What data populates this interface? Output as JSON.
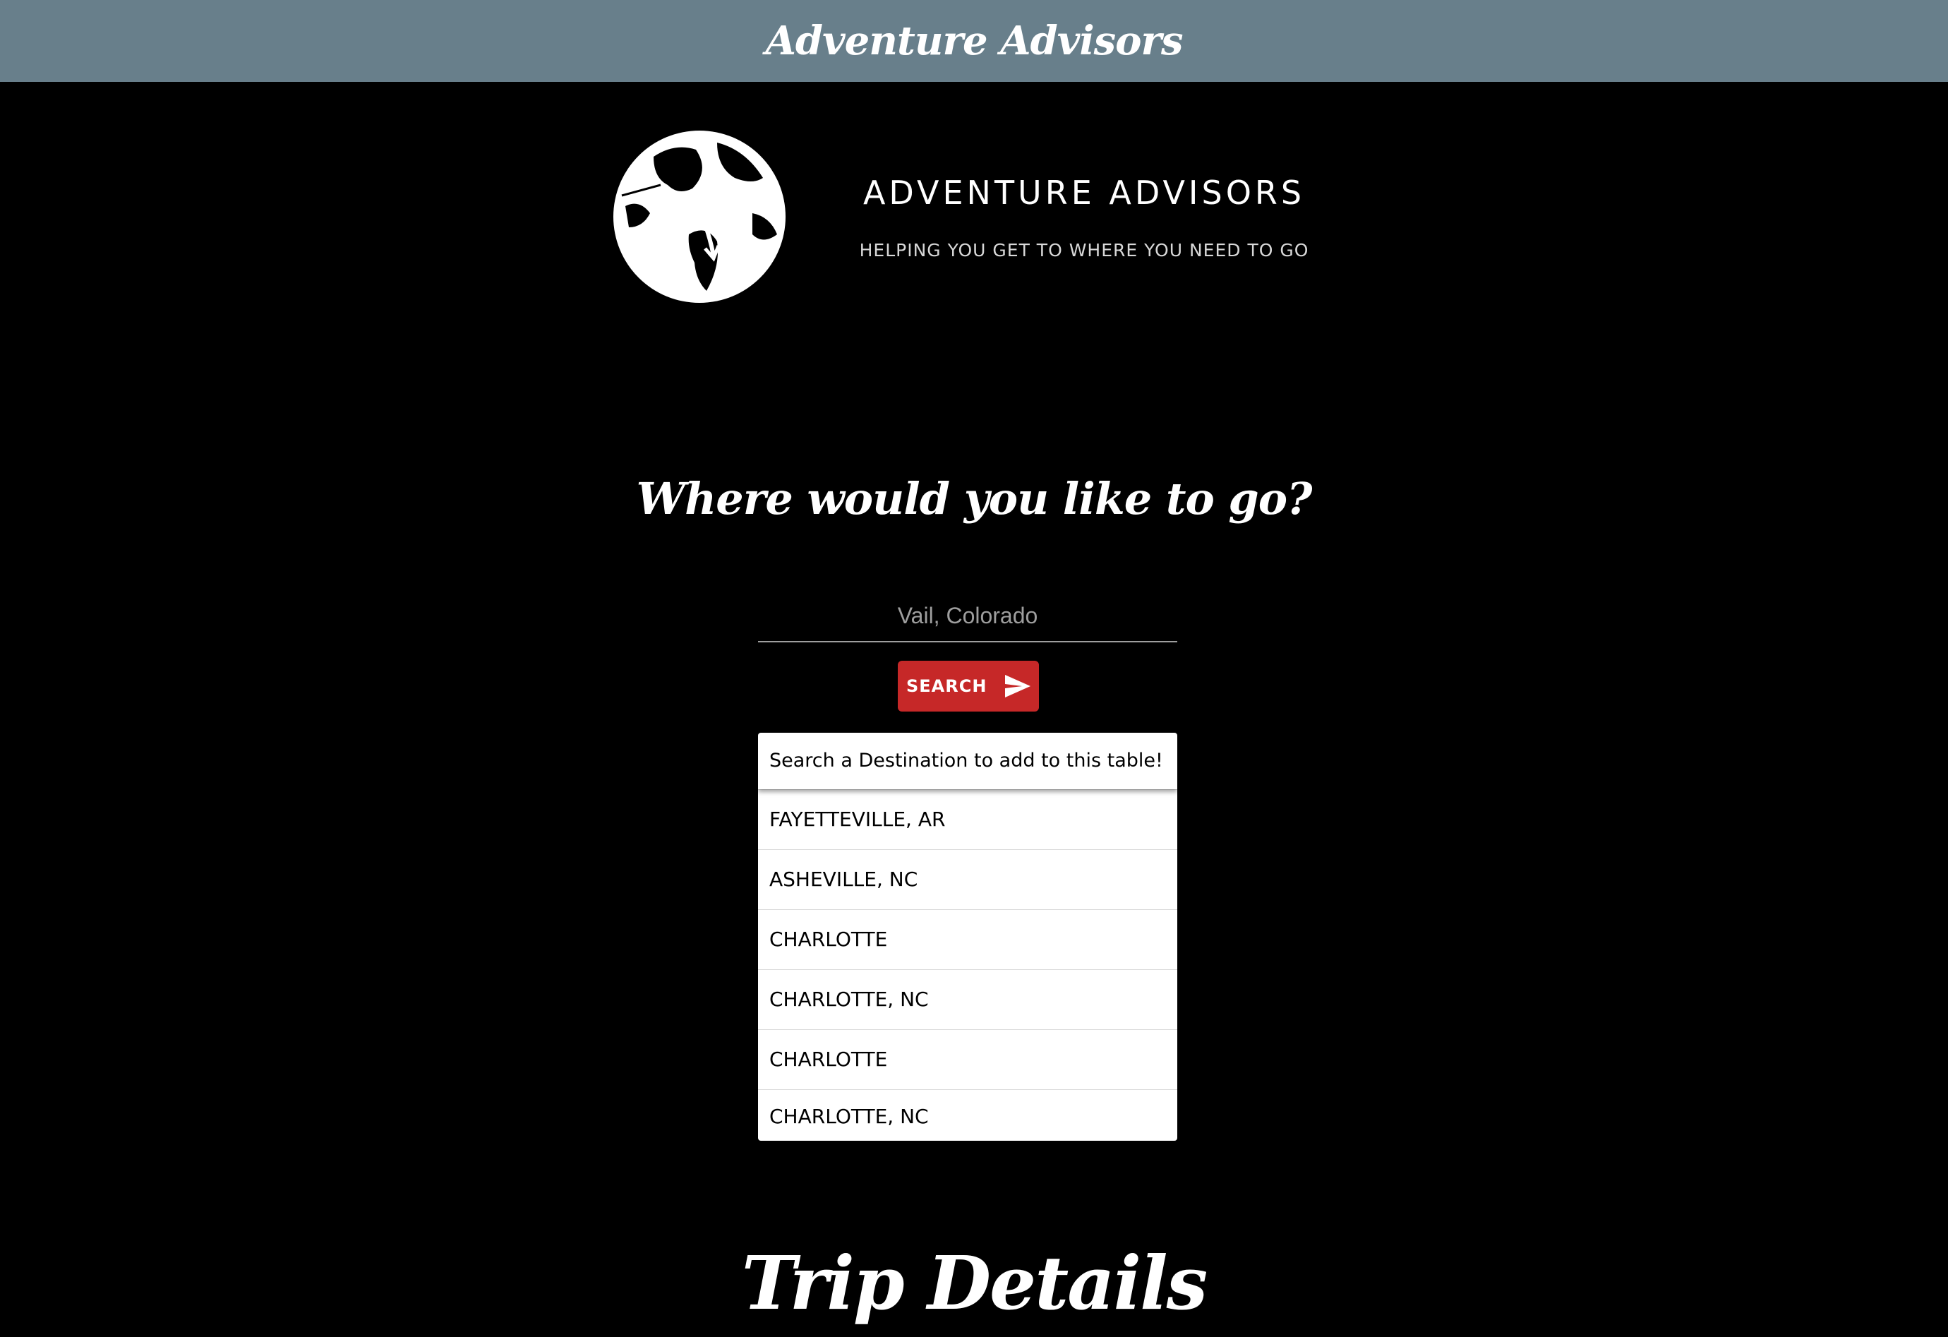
{
  "header": {
    "title": "Adventure Advisors"
  },
  "logo": {
    "name": "ADVENTURE ADVISORS",
    "tagline": "HELPING YOU GET TO WHERE YOU NEED TO GO",
    "icon": "globe-arrows-icon"
  },
  "search": {
    "heading": "Where would you like to go?",
    "placeholder": "Vail, Colorado",
    "button_label": "SEARCH",
    "button_icon": "send-icon",
    "button_color": "#c62828"
  },
  "destinations": {
    "header": "Search a Destination to add to this table!",
    "rows": [
      "FAYETTEVILLE, AR",
      "ASHEVILLE, NC",
      "CHARLOTTE",
      "CHARLOTTE, NC",
      "CHARLOTTE",
      "CHARLOTTE, NC"
    ]
  },
  "trip": {
    "title": "Trip Details"
  },
  "colors": {
    "topbar": "#687f8b",
    "background": "#000000",
    "accent": "#c62828"
  }
}
